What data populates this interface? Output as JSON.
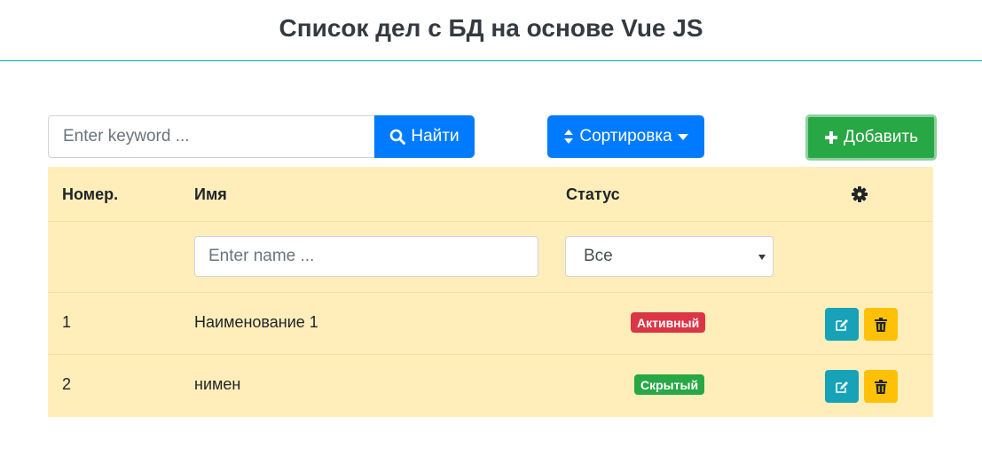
{
  "header": {
    "title": "Список дел с БД на основе Vue JS"
  },
  "toolbar": {
    "search_placeholder": "Enter keyword ...",
    "search_label": "Найти",
    "sort_label": "Сортировка",
    "add_label": "Добавить"
  },
  "table": {
    "columns": {
      "number": "Номер.",
      "name": "Имя",
      "status": "Статус",
      "actions_icon": "gear-icon"
    },
    "filter": {
      "name_placeholder": "Enter name ...",
      "status_selected": "Все"
    },
    "rows": [
      {
        "number": "1",
        "name": "Наименование 1",
        "status": "Активный",
        "status_color": "#dc3545"
      },
      {
        "number": "2",
        "name": "нимен",
        "status": "Скрытый",
        "status_color": "#28a745"
      }
    ]
  },
  "colors": {
    "primary": "#007bff",
    "success": "#28a745",
    "danger": "#dc3545",
    "info": "#17a2b8",
    "warning": "#ffc107",
    "table_bg": "#ffeeba"
  }
}
